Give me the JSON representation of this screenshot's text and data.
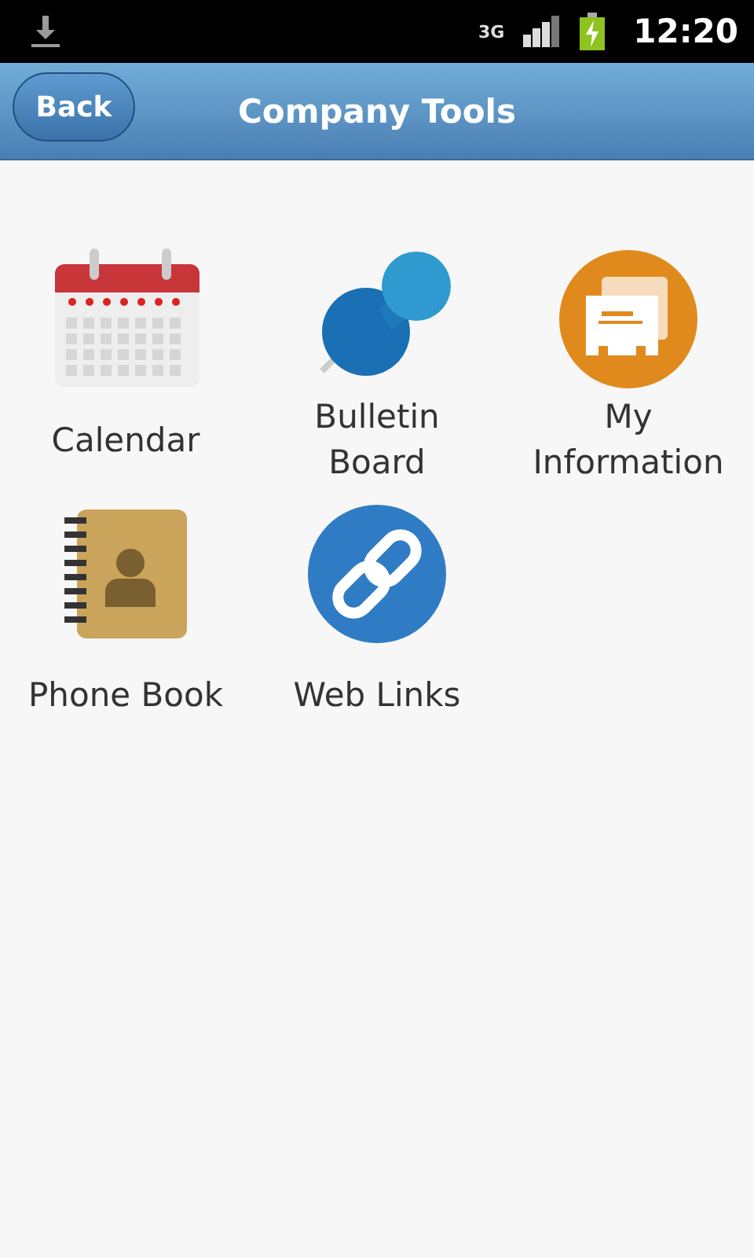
{
  "status_bar": {
    "network": "3G",
    "time": "12:20"
  },
  "header": {
    "back_button": "Back",
    "title": "Company Tools"
  },
  "tools": [
    {
      "kind": "calendar",
      "label": "Calendar"
    },
    {
      "kind": "pin",
      "label": "Bulletin Board"
    },
    {
      "kind": "folder",
      "label": "My Information"
    },
    {
      "kind": "contacts",
      "label": "Phone Book"
    },
    {
      "kind": "link",
      "label": "Web Links"
    }
  ]
}
